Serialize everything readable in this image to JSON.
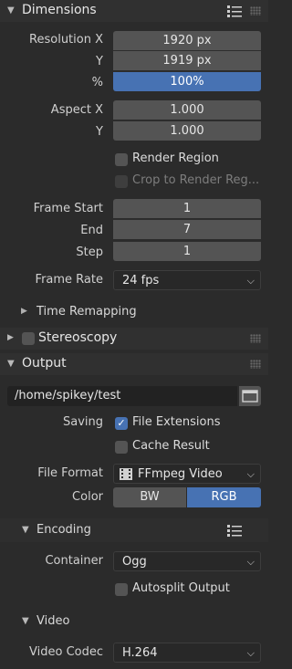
{
  "dimensions": {
    "title": "Dimensions",
    "resolution_x_label": "Resolution X",
    "resolution_x": "1920 px",
    "resolution_y_label": "Y",
    "resolution_y": "1919 px",
    "percent_label": "%",
    "percent": "100%",
    "aspect_x_label": "Aspect X",
    "aspect_x": "1.000",
    "aspect_y_label": "Y",
    "aspect_y": "1.000",
    "render_region_label": "Render Region",
    "crop_label": "Crop to Render Reg...",
    "frame_start_label": "Frame Start",
    "frame_start": "1",
    "frame_end_label": "End",
    "frame_end": "7",
    "frame_step_label": "Step",
    "frame_step": "1",
    "frame_rate_label": "Frame Rate",
    "frame_rate": "24 fps",
    "time_remapping_label": "Time Remapping"
  },
  "stereoscopy": {
    "title": "Stereoscopy"
  },
  "output": {
    "title": "Output",
    "path": "/home/spikey/test",
    "saving_label": "Saving",
    "file_extensions_label": "File Extensions",
    "file_extensions_checked": true,
    "cache_result_label": "Cache Result",
    "file_format_label": "File Format",
    "file_format": "FFmpeg Video",
    "color_label": "Color",
    "color_options": [
      "BW",
      "RGB"
    ],
    "color_selected": "RGB"
  },
  "encoding": {
    "title": "Encoding",
    "container_label": "Container",
    "container": "Ogg",
    "autosplit_label": "Autosplit Output"
  },
  "video": {
    "title": "Video",
    "codec_label": "Video Codec",
    "codec": "H.264"
  },
  "colors": {
    "accent": "#4772b3",
    "panel_bg": "#2b2b2b",
    "header_bg": "#303030",
    "field_bg": "#545454"
  }
}
